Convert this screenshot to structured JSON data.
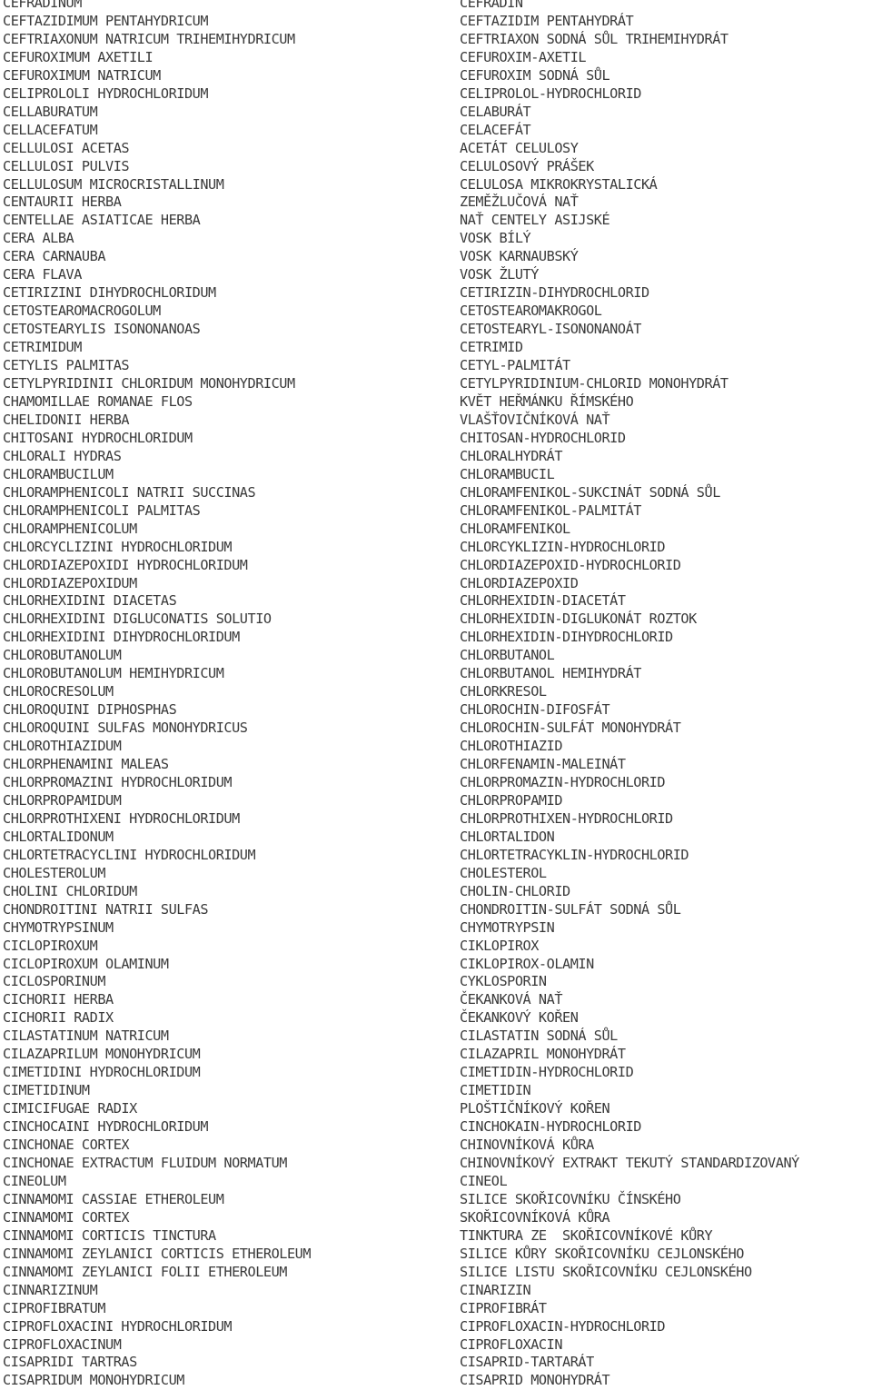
{
  "document": {
    "type": "nomenclature-list",
    "columns": [
      "Latin",
      "Czech"
    ],
    "row_count": 76,
    "text_color": "#3a3a3a",
    "background_color": "#ffffff"
  },
  "rows": [
    {
      "la": "CEFRADINUM",
      "cs": "CEFRADIN"
    },
    {
      "la": "CEFTAZIDIMUM PENTAHYDRICUM",
      "cs": "CEFTAZIDIM PENTAHYDRÁT"
    },
    {
      "la": "CEFTRIAXONUM NATRICUM TRIHEMIHYDRICUM",
      "cs": "CEFTRIAXON SODNÁ SŮL TRIHEMIHYDRÁT"
    },
    {
      "la": "CEFUROXIMUM AXETILI",
      "cs": "CEFUROXIM-AXETIL"
    },
    {
      "la": "CEFUROXIMUM NATRICUM",
      "cs": "CEFUROXIM SODNÁ SŮL"
    },
    {
      "la": "CELIPROLOLI HYDROCHLORIDUM",
      "cs": "CELIPROLOL-HYDROCHLORID"
    },
    {
      "la": "CELLABURATUM",
      "cs": "CELABURÁT"
    },
    {
      "la": "CELLACEFATUM",
      "cs": "CELACEFÁT"
    },
    {
      "la": "CELLULOSI ACETAS",
      "cs": "ACETÁT CELULOSY"
    },
    {
      "la": "CELLULOSI PULVIS",
      "cs": "CELULOSOVÝ PRÁŠEK"
    },
    {
      "la": "CELLULOSUM MICROCRISTALLINUM",
      "cs": "CELULOSA MIKROKRYSTALICKÁ"
    },
    {
      "la": "CENTAURII HERBA",
      "cs": "ZEMĚŽLUČOVÁ NAŤ"
    },
    {
      "la": "CENTELLAE ASIATICAE HERBA",
      "cs": "NAŤ CENTELY ASIJSKÉ"
    },
    {
      "la": "CERA ALBA",
      "cs": "VOSK BÍLÝ"
    },
    {
      "la": "CERA CARNAUBA",
      "cs": "VOSK KARNAUBSKÝ"
    },
    {
      "la": "CERA FLAVA",
      "cs": "VOSK ŽLUTÝ"
    },
    {
      "la": "CETIRIZINI DIHYDROCHLORIDUM",
      "cs": "CETIRIZIN-DIHYDROCHLORID"
    },
    {
      "la": "CETOSTEAROMACROGOLUM",
      "cs": "CETOSTEAROMAKROGOL"
    },
    {
      "la": "CETOSTEARYLIS ISONONANOAS",
      "cs": "CETOSTEARYL-ISONONANOÁT"
    },
    {
      "la": "CETRIMIDUM",
      "cs": "CETRIMID"
    },
    {
      "la": "CETYLIS PALMITAS",
      "cs": "CETYL-PALMITÁT"
    },
    {
      "la": "CETYLPYRIDINII CHLORIDUM MONOHYDRICUM",
      "cs": "CETYLPYRIDINIUM-CHLORID MONOHYDRÁT"
    },
    {
      "la": "CHAMOMILLAE ROMANAE FLOS",
      "cs": "KVĚT HEŘMÁNKU ŘÍMSKÉHO"
    },
    {
      "la": "CHELIDONII HERBA",
      "cs": "VLAŠŤOVIČNÍKOVÁ NAŤ"
    },
    {
      "la": "CHITOSANI HYDROCHLORIDUM",
      "cs": "CHITOSAN-HYDROCHLORID"
    },
    {
      "la": "CHLORALI HYDRAS",
      "cs": "CHLORALHYDRÁT"
    },
    {
      "la": "CHLORAMBUCILUM",
      "cs": "CHLORAMBUCIL"
    },
    {
      "la": "CHLORAMPHENICOLI NATRII SUCCINAS",
      "cs": "CHLORAMFENIKOL-SUKCINÁT SODNÁ SŮL"
    },
    {
      "la": "CHLORAMPHENICOLI PALMITAS",
      "cs": "CHLORAMFENIKOL-PALMITÁT"
    },
    {
      "la": "CHLORAMPHENICOLUM",
      "cs": "CHLORAMFENIKOL"
    },
    {
      "la": "CHLORCYCLIZINI HYDROCHLORIDUM",
      "cs": "CHLORCYKLIZIN-HYDROCHLORID"
    },
    {
      "la": "CHLORDIAZEPOXIDI HYDROCHLORIDUM",
      "cs": "CHLORDIAZEPOXID-HYDROCHLORID"
    },
    {
      "la": "CHLORDIAZEPOXIDUM",
      "cs": "CHLORDIAZEPOXID"
    },
    {
      "la": "CHLORHEXIDINI DIACETAS",
      "cs": "CHLORHEXIDIN-DIACETÁT"
    },
    {
      "la": "CHLORHEXIDINI DIGLUCONATIS SOLUTIO",
      "cs": "CHLORHEXIDIN-DIGLUKONÁT ROZTOK"
    },
    {
      "la": "CHLORHEXIDINI DIHYDROCHLORIDUM",
      "cs": "CHLORHEXIDIN-DIHYDROCHLORID"
    },
    {
      "la": "CHLOROBUTANOLUM",
      "cs": "CHLORBUTANOL"
    },
    {
      "la": "CHLOROBUTANOLUM HEMIHYDRICUM",
      "cs": "CHLORBUTANOL HEMIHYDRÁT"
    },
    {
      "la": "CHLOROCRESOLUM",
      "cs": "CHLORKRESOL"
    },
    {
      "la": "CHLOROQUINI DIPHOSPHAS",
      "cs": "CHLOROCHIN-DIFOSFÁT"
    },
    {
      "la": "CHLOROQUINI SULFAS MONOHYDRICUS",
      "cs": "CHLOROCHIN-SULFÁT MONOHYDRÁT"
    },
    {
      "la": "CHLOROTHIAZIDUM",
      "cs": "CHLOROTHIAZID"
    },
    {
      "la": "CHLORPHENAMINI MALEAS",
      "cs": "CHLORFENAMIN-MALEINÁT"
    },
    {
      "la": "CHLORPROMAZINI HYDROCHLORIDUM",
      "cs": "CHLORPROMAZIN-HYDROCHLORID"
    },
    {
      "la": "CHLORPROPAMIDUM",
      "cs": "CHLORPROPAMID"
    },
    {
      "la": "CHLORPROTHIXENI HYDROCHLORIDUM",
      "cs": "CHLORPROTHIXEN-HYDROCHLORID"
    },
    {
      "la": "CHLORTALIDONUM",
      "cs": "CHLORTALIDON"
    },
    {
      "la": "CHLORTETRACYCLINI HYDROCHLORIDUM",
      "cs": "CHLORTETRACYKLIN-HYDROCHLORID"
    },
    {
      "la": "CHOLESTEROLUM",
      "cs": "CHOLESTEROL"
    },
    {
      "la": "CHOLINI CHLORIDUM",
      "cs": "CHOLIN-CHLORID"
    },
    {
      "la": "CHONDROITINI NATRII SULFAS",
      "cs": "CHONDROITIN-SULFÁT SODNÁ SŮL"
    },
    {
      "la": "CHYMOTRYPSINUM",
      "cs": "CHYMOTRYPSIN"
    },
    {
      "la": "CICLOPIROXUM",
      "cs": "CIKLOPIROX"
    },
    {
      "la": "CICLOPIROXUM OLAMINUM",
      "cs": "CIKLOPIROX-OLAMIN"
    },
    {
      "la": "CICLOSPORINUM",
      "cs": "CYKLOSPORIN"
    },
    {
      "la": "CICHORII HERBA",
      "cs": "ČEKANKOVÁ NAŤ"
    },
    {
      "la": "CICHORII RADIX",
      "cs": "ČEKANKOVÝ KOŘEN"
    },
    {
      "la": "CILASTATINUM NATRICUM",
      "cs": "CILASTATIN SODNÁ SŮL"
    },
    {
      "la": "CILAZAPRILUM MONOHYDRICUM",
      "cs": "CILAZAPRIL MONOHYDRÁT"
    },
    {
      "la": "CIMETIDINI HYDROCHLORIDUM",
      "cs": "CIMETIDIN-HYDROCHLORID"
    },
    {
      "la": "CIMETIDINUM",
      "cs": "CIMETIDIN"
    },
    {
      "la": "CIMICIFUGAE RADIX",
      "cs": "PLOŠTIČNÍKOVÝ KOŘEN"
    },
    {
      "la": "CINCHOCAINI HYDROCHLORIDUM",
      "cs": "CINCHOKAIN-HYDROCHLORID"
    },
    {
      "la": "CINCHONAE CORTEX",
      "cs": "CHINOVNÍKOVÁ KŮRA"
    },
    {
      "la": "CINCHONAE EXTRACTUM FLUIDUM NORMATUM",
      "cs": "CHINOVNÍKOVÝ EXTRAKT TEKUTÝ STANDARDIZOVANÝ"
    },
    {
      "la": "CINEOLUM",
      "cs": "CINEOL"
    },
    {
      "la": "CINNAMOMI CASSIAE ETHEROLEUM",
      "cs": "SILICE SKOŘICOVNÍKU ČÍNSKÉHO"
    },
    {
      "la": "CINNAMOMI CORTEX",
      "cs": "SKOŘICOVNÍKOVÁ KŮRA"
    },
    {
      "la": "CINNAMOMI CORTICIS TINCTURA",
      "cs": "TINKTURA ZE  SKOŘICOVNÍKOVÉ KŮRY"
    },
    {
      "la": "CINNAMOMI ZEYLANICI CORTICIS ETHEROLEUM",
      "cs": "SILICE KŮRY SKOŘICOVNÍKU CEJLONSKÉHO"
    },
    {
      "la": "CINNAMOMI ZEYLANICI FOLII ETHEROLEUM",
      "cs": "SILICE LISTU SKOŘICOVNÍKU CEJLONSKÉHO"
    },
    {
      "la": "CINNARIZINUM",
      "cs": "CINARIZIN"
    },
    {
      "la": "CIPROFIBRATUM",
      "cs": "CIPROFIBRÁT"
    },
    {
      "la": "CIPROFLOXACINI HYDROCHLORIDUM",
      "cs": "CIPROFLOXACIN-HYDROCHLORID"
    },
    {
      "la": "CIPROFLOXACINUM",
      "cs": "CIPROFLOXACIN"
    },
    {
      "la": "CISAPRIDI TARTRAS",
      "cs": "CISAPRID-TARTARÁT"
    },
    {
      "la": "CISAPRIDUM MONOHYDRICUM",
      "cs": "CISAPRID MONOHYDRÁT"
    }
  ]
}
